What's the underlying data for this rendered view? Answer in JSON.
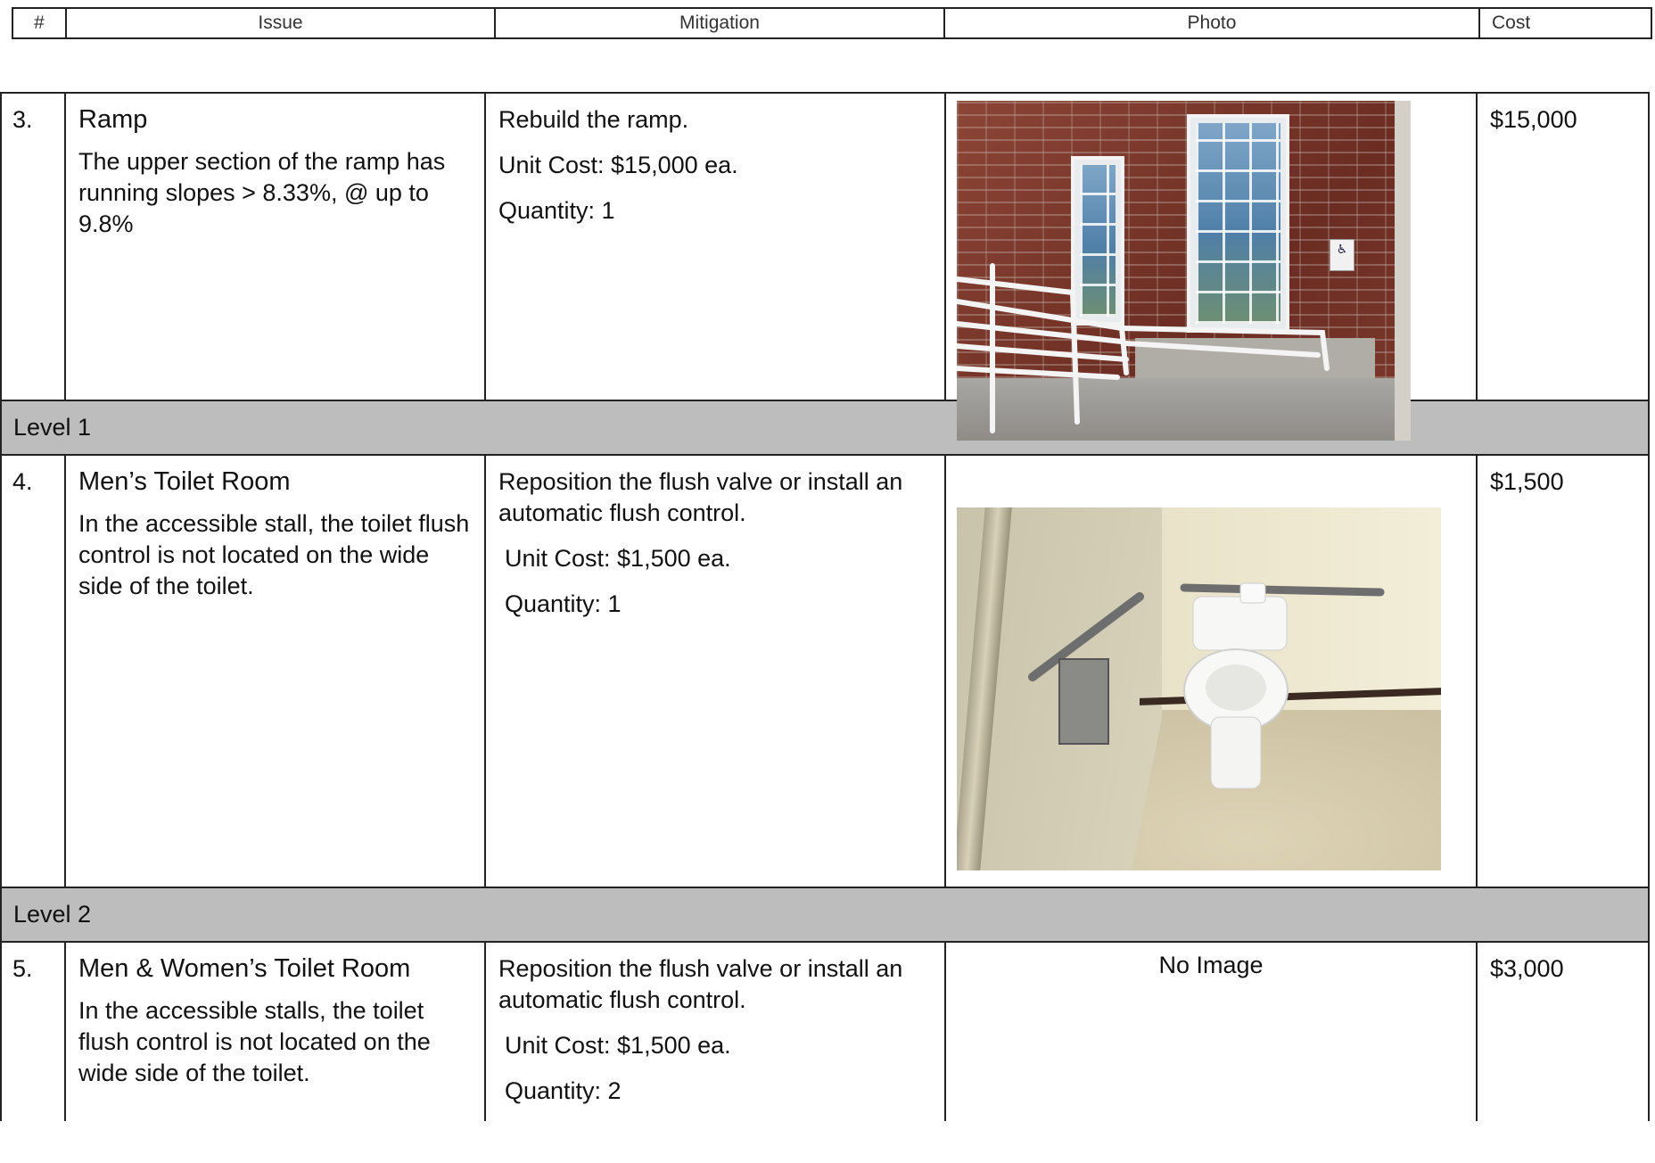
{
  "header": {
    "col_num": "#",
    "col_issue": "Issue",
    "col_mitigation": "Mitigation",
    "col_photo": "Photo",
    "col_cost": "Cost"
  },
  "rows": [
    {
      "num": "3.",
      "issue_title": "Ramp",
      "issue_text": "The upper section of the ramp has running slopes > 8.33%, @ up to 9.8%",
      "mitigation": "Rebuild the ramp.",
      "unit_cost": "Unit Cost: $15,000 ea.",
      "quantity": "Quantity: 1",
      "photo": "ramp-photo",
      "cost": "$15,000"
    },
    {
      "level": "Level 1"
    },
    {
      "num": "4.",
      "issue_title": "Men’s Toilet Room",
      "issue_text": "In the accessible stall, the toilet flush control is not located on the wide side of the toilet.",
      "mitigation": "Reposition the flush valve or install an automatic flush control.",
      "unit_cost": "Unit Cost: $1,500 ea.",
      "quantity": "Quantity: 1",
      "photo": "toilet-stall-photo",
      "cost": "$1,500"
    },
    {
      "level": "Level 2"
    },
    {
      "num": "5.",
      "issue_title": "Men & Women’s Toilet Room",
      "issue_text": "In the accessible stalls, the toilet flush control is not located on the wide side of the toilet.",
      "mitigation": "Reposition the flush valve or install an automatic flush control.",
      "unit_cost": "Unit Cost: $1,500 ea.",
      "quantity": "Quantity: 2",
      "photo_text": "No Image",
      "cost": "$3,000"
    }
  ],
  "colors": {
    "border": "#222222",
    "level_band": "#bdbdbd"
  }
}
